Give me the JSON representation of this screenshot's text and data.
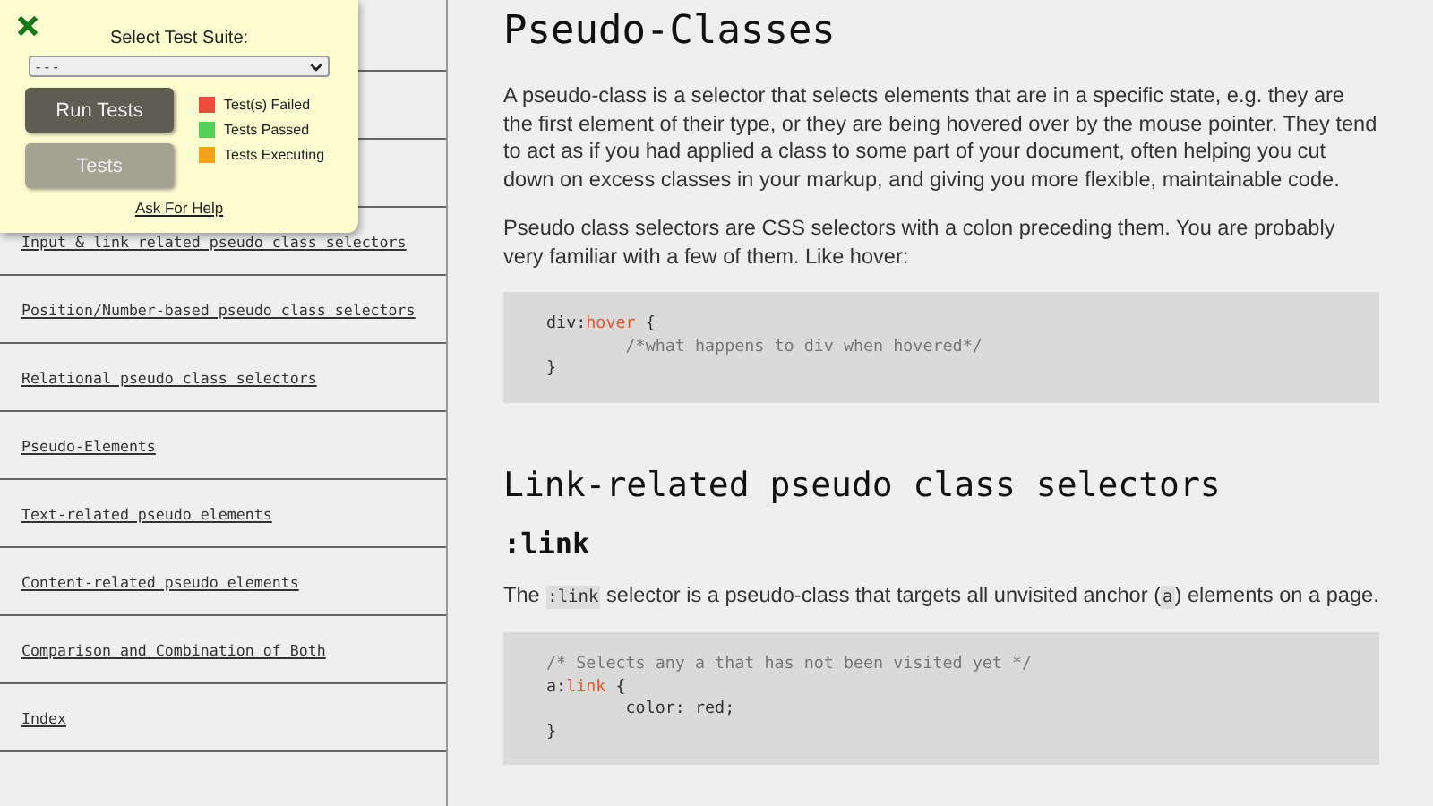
{
  "sidebar": {
    "items": [
      {
        "label": "Input & link related pseudo class selectors"
      },
      {
        "label": "Position/Number-based pseudo class selectors"
      },
      {
        "label": "Relational pseudo class selectors"
      },
      {
        "label": "Pseudo-Elements"
      },
      {
        "label": "Text-related pseudo elements"
      },
      {
        "label": "Content-related pseudo elements"
      },
      {
        "label": "Comparison and Combination of Both"
      },
      {
        "label": "Index"
      }
    ]
  },
  "test_panel": {
    "title": "Select Test Suite:",
    "select_value": "- - -",
    "buttons": [
      {
        "label": "Run Tests",
        "kind": "primary"
      },
      {
        "label": "Tests",
        "kind": "secondary"
      }
    ],
    "legend": [
      {
        "label": "Test(s) Failed",
        "color": "#f04a3c"
      },
      {
        "label": "Tests Passed",
        "color": "#55d155"
      },
      {
        "label": "Tests Executing",
        "color": "#f5a11c"
      }
    ],
    "help_link": "Ask For Help"
  },
  "content": [
    {
      "kind": "h1",
      "text": "Pseudo-Classes"
    },
    {
      "kind": "p",
      "parts": [
        {
          "kind": "text",
          "text": "A pseudo-class is a selector that selects elements that are in a specific state, e.g. they are the first element of their type, or they are being hovered over by the mouse pointer. They tend to act as if you had applied a class to some part of your document, often helping you cut down on excess classes in your markup, and giving you more flexible, maintainable code."
        }
      ]
    },
    {
      "kind": "p",
      "parts": [
        {
          "kind": "text",
          "text": "Pseudo class selectors are CSS selectors with a colon preceding them. You are probably very familiar with a few of them. Like hover:"
        }
      ]
    },
    {
      "kind": "code",
      "lines": [
        [
          {
            "kind": "plain",
            "text": "div:"
          },
          {
            "kind": "keyword",
            "text": "hover"
          },
          {
            "kind": "plain",
            "text": " {"
          }
        ],
        [
          {
            "kind": "comment",
            "text": "        /*what happens to div when hovered*/"
          }
        ],
        [
          {
            "kind": "plain",
            "text": "}"
          }
        ]
      ]
    },
    {
      "kind": "h2",
      "text": "Link-related pseudo class selectors"
    },
    {
      "kind": "h3",
      "text": ":link"
    },
    {
      "kind": "p",
      "parts": [
        {
          "kind": "text",
          "text": "The "
        },
        {
          "kind": "code",
          "text": ":link"
        },
        {
          "kind": "text",
          "text": " selector is a pseudo-class that targets all unvisited anchor ("
        },
        {
          "kind": "code",
          "text": "a"
        },
        {
          "kind": "text",
          "text": ") elements on a page."
        }
      ]
    },
    {
      "kind": "code",
      "lines": [
        [
          {
            "kind": "comment",
            "text": "/* Selects any a that has not been visited yet */"
          }
        ],
        [
          {
            "kind": "plain",
            "text": "a:"
          },
          {
            "kind": "keyword",
            "text": "link"
          },
          {
            "kind": "plain",
            "text": " {"
          }
        ],
        [
          {
            "kind": "plain",
            "text": "        color: red;"
          }
        ],
        [
          {
            "kind": "plain",
            "text": "}"
          }
        ]
      ]
    }
  ]
}
